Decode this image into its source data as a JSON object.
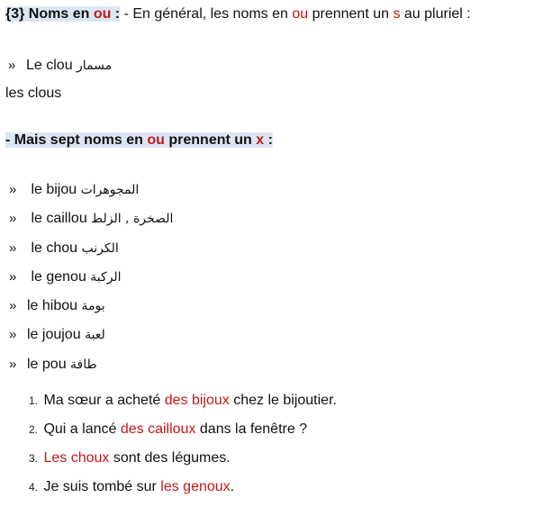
{
  "section3": {
    "label": "{3} Noms en ",
    "label_red": "ou",
    "label_end": " :",
    "rule_a": " - En général, les noms en ",
    "rule_ou": "ou",
    "rule_b": " prennent un ",
    "rule_s": "s",
    "rule_c": " au pluriel :"
  },
  "example": {
    "bullet": "»",
    "singular": "Le clou",
    "arabic": "مسمار",
    "plural": "les clous"
  },
  "exception_heading": {
    "a": "- Mais sept noms en ",
    "ou": "ou",
    "b": " prennent un ",
    "x": "x",
    "c": " :"
  },
  "exceptions": [
    {
      "bullet": "»",
      "word": "le bijou",
      "arabic": "المجوهرات"
    },
    {
      "bullet": "»",
      "word": "le caillou",
      "arabic": "الصخرة , الزلط"
    },
    {
      "bullet": "»",
      "word": "le chou",
      "arabic": "الكرنب"
    },
    {
      "bullet": "»",
      "word": "le genou",
      "arabic": "الركبة"
    },
    {
      "bullet": "»",
      "word": "le hibou",
      "arabic": "بومة"
    },
    {
      "bullet": "»",
      "word": "le joujou",
      "arabic": "لعبة"
    },
    {
      "bullet": "»",
      "word": "le pou",
      "arabic": "طافة"
    }
  ],
  "sentences": [
    {
      "num": "1.",
      "pre": "Ma sœur a acheté ",
      "red": "des bijoux",
      "post": " chez le bijoutier."
    },
    {
      "num": "2.",
      "pre": "Qui a lancé ",
      "red": "des cailloux",
      "post": " dans la fenêtre ?"
    },
    {
      "num": "3.",
      "pre": "",
      "red": "Les choux",
      "post": " sont des légumes."
    },
    {
      "num": "4.",
      "pre": "Je suis tombé sur ",
      "red": "les genoux",
      "post": "."
    }
  ],
  "colors": {
    "accent_red": "#c0181c",
    "highlight": "#dce6f2"
  }
}
